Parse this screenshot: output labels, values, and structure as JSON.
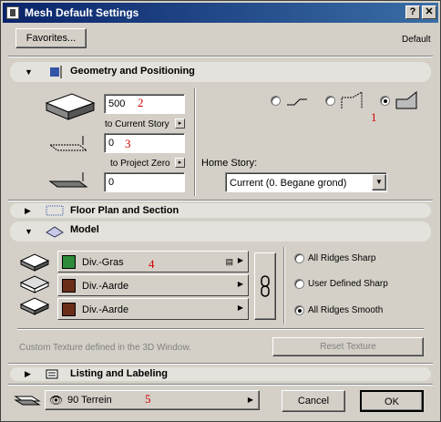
{
  "window": {
    "title": "Mesh Default Settings",
    "help_btn": "?",
    "close_btn": "✕"
  },
  "top": {
    "favorites_label": "Favorites...",
    "default_label": "Default"
  },
  "geometry": {
    "header": "Geometry and Positioning",
    "height_value": "500",
    "to_current_story": "to Current Story",
    "offset_value": "0",
    "to_project_zero": "to Project Zero",
    "bottom_value": "0",
    "home_story_label": "Home Story:",
    "home_story_value": "Current (0. Begane grond)"
  },
  "floor_plan": {
    "header": "Floor Plan and Section"
  },
  "model": {
    "header": "Model",
    "surfaces": [
      {
        "name": "Div.-Gras",
        "color": "#2e8b3a"
      },
      {
        "name": "Div.-Aarde",
        "color": "#6b2e1a"
      },
      {
        "name": "Div.-Aarde",
        "color": "#6b2e1a"
      }
    ],
    "ridge_options": [
      "All Ridges Sharp",
      "User Defined Sharp",
      "All Ridges Smooth"
    ],
    "ridge_selected": "All Ridges Smooth",
    "texture_note": "Custom Texture defined in the 3D Window.",
    "reset_texture": "Reset Texture"
  },
  "listing": {
    "header": "Listing and Labeling"
  },
  "bottom": {
    "layer": "90 Terrein",
    "cancel": "Cancel",
    "ok": "OK"
  },
  "annotations": {
    "n1": "1",
    "n2": "2",
    "n3": "3",
    "n4": "4",
    "n5": "5"
  }
}
